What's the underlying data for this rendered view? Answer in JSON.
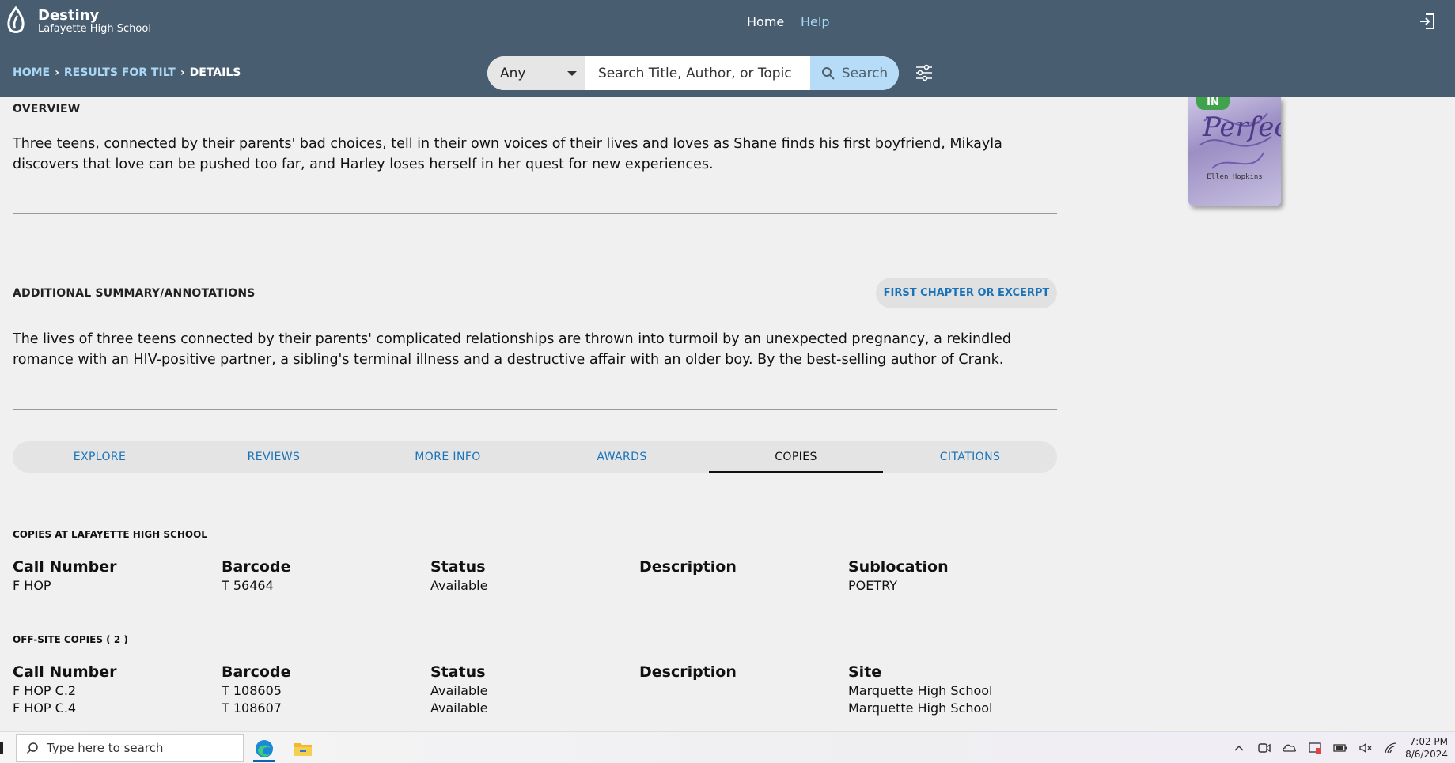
{
  "header": {
    "brand_name": "Destiny",
    "school": "Lafayette High School",
    "nav": {
      "home": "Home",
      "help": "Help"
    }
  },
  "breadcrumb": {
    "home": "HOME",
    "results": "RESULTS FOR TILT",
    "current": "DETAILS"
  },
  "search": {
    "scope": "Any",
    "placeholder": "Search Title, Author, or Topic",
    "button_label": "Search"
  },
  "overview": {
    "heading": "OVERVIEW",
    "text": "Three teens, connected by their parents' bad choices, tell in their own voices of their lives and loves as Shane finds his first boyfriend, Mikayla discovers that love can be pushed too far, and Harley loses herself in her quest for new experiences."
  },
  "cover": {
    "badge": "IN",
    "title": "Perfect",
    "author": "Ellen Hopkins"
  },
  "summary": {
    "heading": "ADDITIONAL SUMMARY/ANNOTATIONS",
    "excerpt_button": "FIRST CHAPTER OR EXCERPT",
    "text": "The lives of three teens connected by their parents' complicated relationships are thrown into turmoil by an unexpected pregnancy, a rekindled romance with an HIV-positive partner, a sibling's terminal illness and a destructive affair with an older boy. By the best-selling author of Crank."
  },
  "tabs": [
    "EXPLORE",
    "REVIEWS",
    "MORE INFO",
    "AWARDS",
    "COPIES",
    "CITATIONS"
  ],
  "active_tab": "COPIES",
  "copies_local": {
    "heading": "COPIES AT LAFAYETTE HIGH SCHOOL",
    "columns": [
      "Call Number",
      "Barcode",
      "Status",
      "Description",
      "Sublocation"
    ],
    "rows": [
      [
        "F HOP",
        "T 56464",
        "Available",
        "",
        "POETRY"
      ]
    ]
  },
  "copies_offsite": {
    "heading": "OFF-SITE COPIES ( 2 )",
    "columns": [
      "Call Number",
      "Barcode",
      "Status",
      "Description",
      "Site"
    ],
    "rows": [
      [
        "F HOP C.2",
        "T 108605",
        "Available",
        "",
        "Marquette High School"
      ],
      [
        "F HOP C.4",
        "T 108607",
        "Available",
        "",
        "Marquette High School"
      ]
    ]
  },
  "taskbar": {
    "search_placeholder": "Type here to search",
    "time": "7:02 PM",
    "date": "8/6/2024"
  },
  "colors": {
    "header_bg": "#485d70",
    "link": "#1a73b8",
    "header_link": "#a9d7f5",
    "search_btn": "#b7dcf7"
  },
  "icons": [
    "destiny-logo-icon",
    "sign-in-icon",
    "search-icon",
    "filter-sliders-icon",
    "edge-icon",
    "file-explorer-icon"
  ]
}
